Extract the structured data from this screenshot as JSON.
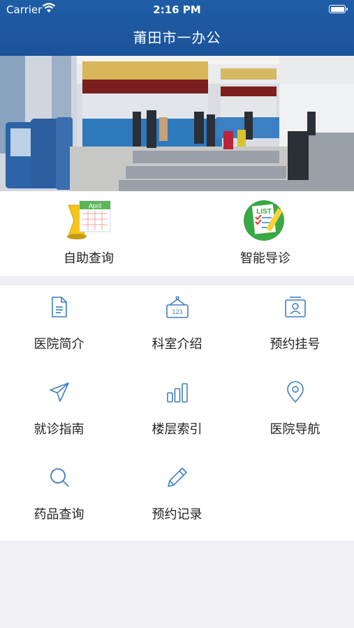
{
  "status_bar": {
    "carrier": "Carrier",
    "time": "2:16 PM"
  },
  "header": {
    "title": "莆田市一办公"
  },
  "quick_actions": [
    {
      "label": "自助查询",
      "icon": "calendar-hourglass-icon",
      "icon_text": "April"
    },
    {
      "label": "智能导诊",
      "icon": "checklist-icon",
      "icon_text": "LIST"
    }
  ],
  "menu": [
    {
      "label": "医院简介",
      "icon": "document-icon"
    },
    {
      "label": "科室介绍",
      "icon": "signboard-icon",
      "icon_text": "123"
    },
    {
      "label": "预约挂号",
      "icon": "id-card-icon"
    },
    {
      "label": "就诊指南",
      "icon": "paper-plane-icon"
    },
    {
      "label": "楼层索引",
      "icon": "bar-chart-icon"
    },
    {
      "label": "医院导航",
      "icon": "location-pin-icon"
    },
    {
      "label": "药品查询",
      "icon": "search-icon"
    },
    {
      "label": "预约记录",
      "icon": "pencil-icon"
    }
  ],
  "colors": {
    "header": "#1f5da6",
    "icon_blue": "#3f7fc0",
    "background": "#efeff4"
  }
}
